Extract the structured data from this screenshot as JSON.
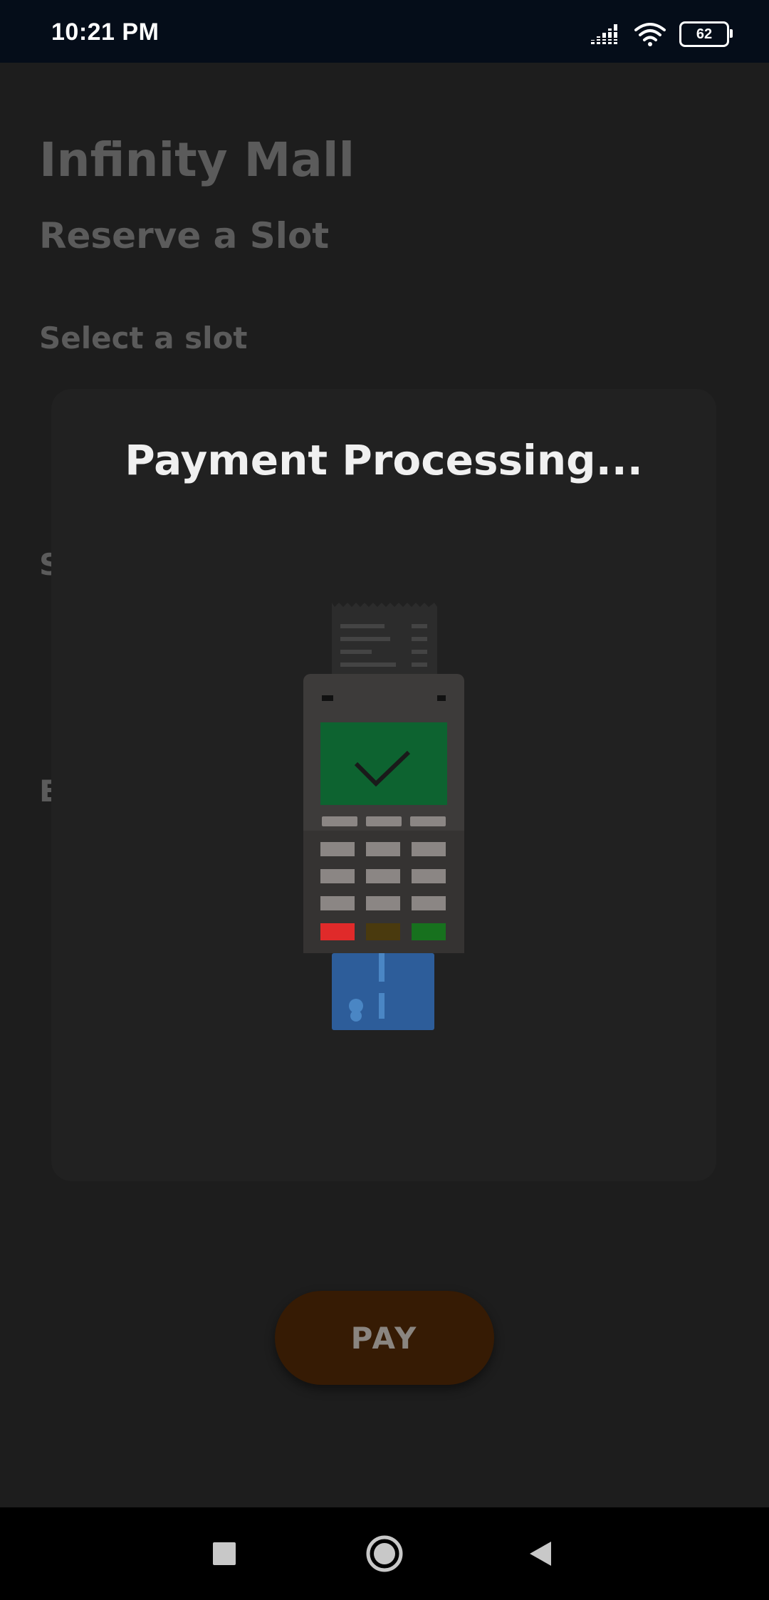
{
  "status_bar": {
    "time": "10:21 PM",
    "battery": "62"
  },
  "page": {
    "mall_name": "Infinity Mall",
    "subtitle": "Reserve a Slot",
    "select_slot_label": "Select a slot",
    "partial_label_1": "S",
    "partial_label_2": "E",
    "pay_label": "PAY"
  },
  "dialog": {
    "title": "Payment Processing..."
  },
  "colors": {
    "background": "#1d1d1d",
    "dialog": "#212121",
    "pay_button": "#361b04",
    "terminal_screen": "#0d6330",
    "card": "#2d5d9a"
  },
  "icons": {
    "nav_recent": "square-icon",
    "nav_home": "circle-home-icon",
    "nav_back": "triangle-back-icon"
  }
}
